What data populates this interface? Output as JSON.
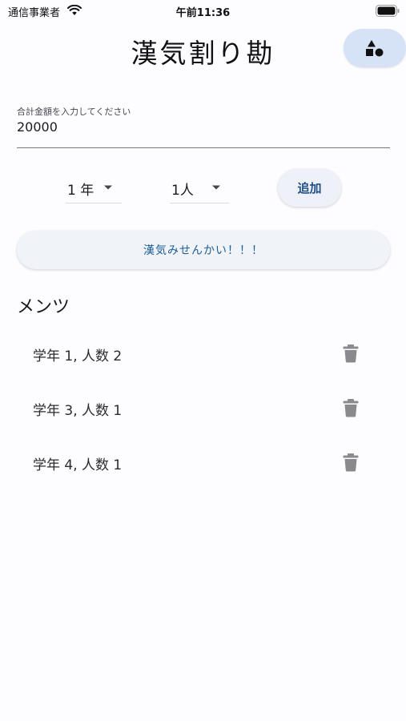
{
  "status_bar": {
    "carrier": "通信事業者",
    "time": "午前11:36"
  },
  "app_bar": {
    "title": "漢気割り勘",
    "action_icon": "shapes-icon"
  },
  "amount_field": {
    "label": "合計金額を入力してください",
    "value": "20000"
  },
  "grade_dropdown": {
    "selected": "1 年"
  },
  "count_dropdown": {
    "selected": "1人"
  },
  "add_button": {
    "label": "追加"
  },
  "calc_button": {
    "label": "漢気みせんかい！！！"
  },
  "members_section": {
    "title": "メンツ",
    "items": [
      {
        "label": "学年 1, 人数 2"
      },
      {
        "label": "学年 3, 人数 1"
      },
      {
        "label": "学年 4, 人数 1"
      }
    ]
  },
  "colors": {
    "background": "#fdfcff",
    "fab_background": "#d6e3f7",
    "button_background": "#eef1f7",
    "accent_text": "#1f5f96",
    "icon_gray": "#8a8a8e"
  }
}
